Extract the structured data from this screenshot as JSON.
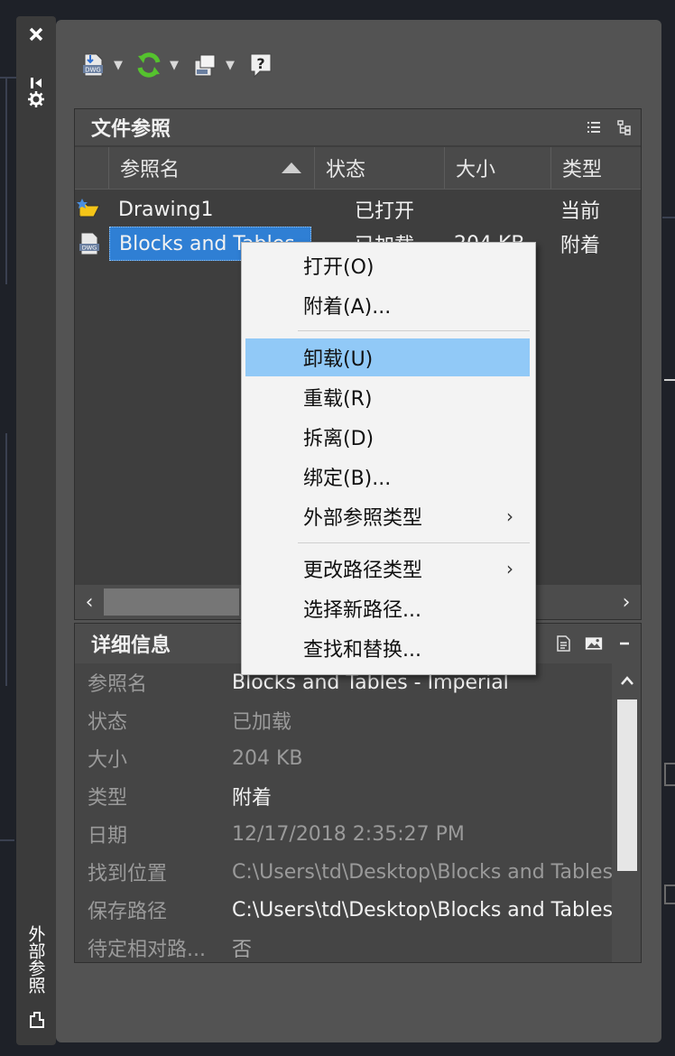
{
  "side_strip": {
    "title": "外部参照"
  },
  "files_panel": {
    "title": "文件参照",
    "columns": [
      "参照名",
      "状态",
      "大小",
      "类型"
    ],
    "rows": [
      {
        "name": "Drawing1",
        "status": "已打开",
        "size": "",
        "type": "当前"
      },
      {
        "name": "Blocks and Tables - Imperial",
        "status": "已加载",
        "size": "204 KB",
        "type": "附着"
      }
    ]
  },
  "details_panel": {
    "title": "详细信息",
    "rows": [
      {
        "label": "参照名",
        "value": "Blocks and Tables - Imperial"
      },
      {
        "label": "状态",
        "value": "已加载"
      },
      {
        "label": "大小",
        "value": "204 KB"
      },
      {
        "label": "类型",
        "value": "附着"
      },
      {
        "label": "日期",
        "value": "12/17/2018 2:35:27 PM"
      },
      {
        "label": "找到位置",
        "value": "C:\\Users\\td\\Desktop\\Blocks and Tables"
      },
      {
        "label": "保存路径",
        "value": "C:\\Users\\td\\Desktop\\Blocks and Tables"
      },
      {
        "label": "待定相对路...",
        "value": "否"
      }
    ]
  },
  "context_menu": {
    "items": [
      {
        "label": "打开(O)"
      },
      {
        "label": "附着(A)..."
      },
      {
        "label": "卸载(U)"
      },
      {
        "label": "重载(R)"
      },
      {
        "label": "拆离(D)"
      },
      {
        "label": "绑定(B)..."
      },
      {
        "label": "外部参照类型",
        "submenu": "›"
      },
      {
        "label": "更改路径类型",
        "submenu": "›"
      },
      {
        "label": "选择新路径..."
      },
      {
        "label": "查找和替换..."
      }
    ]
  },
  "colors": {
    "accent_green": "#55c22e",
    "selection_blue": "#2f7fd4",
    "menu_highlight": "#91c9f7"
  }
}
